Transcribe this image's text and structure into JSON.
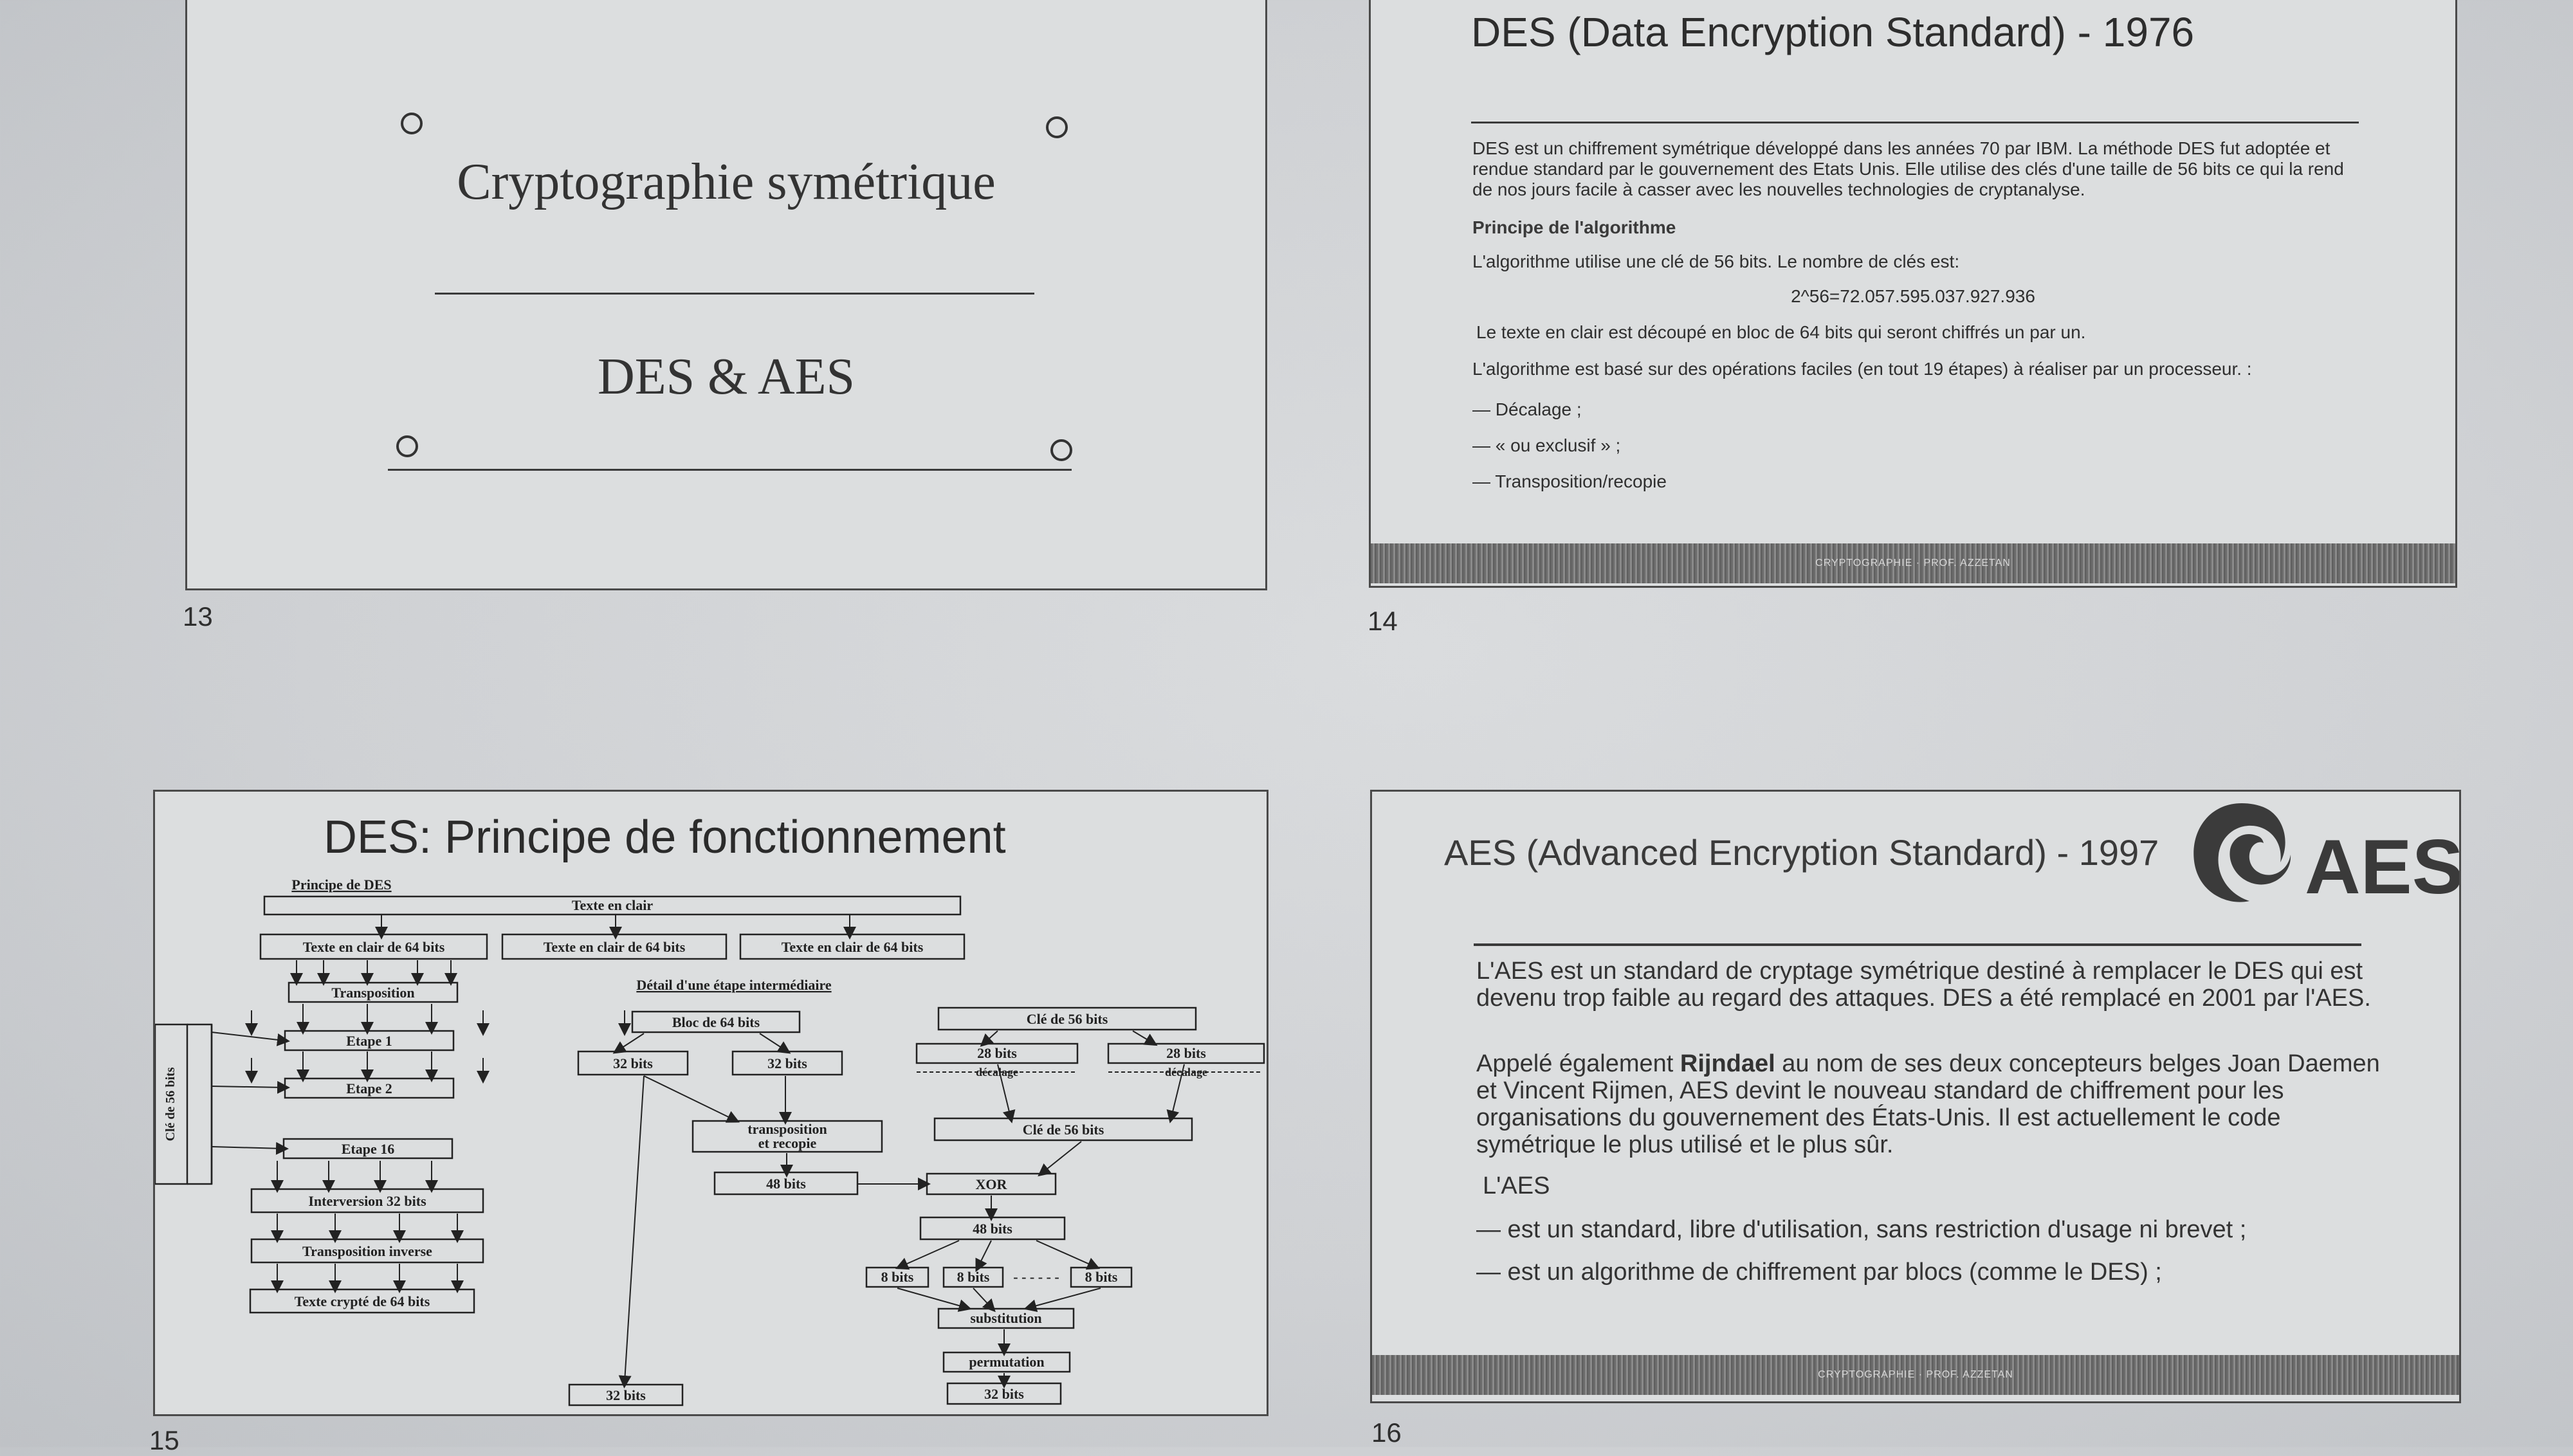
{
  "slides": {
    "s13": {
      "title": "Cryptographie symétrique",
      "subtitle": "DES & AES",
      "page_number": "13"
    },
    "s14": {
      "title": "DES (Data Encryption Standard) - 1976",
      "intro": "DES est un chiffrement symétrique développé dans les années 70 par IBM. La méthode DES fut adoptée et rendue standard par le gouvernement des Etats Unis. Elle utilise des clés d'une taille de 56 bits ce qui la rend de nos jours facile à casser avec les nouvelles technologies de cryptanalyse.",
      "section": "Principe de l'algorithme",
      "key_line": "L'algorithme utilise une clé de 56 bits. Le nombre de clés est:",
      "formula": "2^56=72.057.595.037.927.936",
      "block_line": "Le texte en clair est découpé en bloc de 64 bits qui seront chiffrés un par un.",
      "ops_line": "L'algorithme est basé sur des opérations faciles (en tout 19 étapes) à réaliser par un processeur. :",
      "ops": [
        "— Décalage ;",
        "— « ou exclusif » ;",
        "— Transposition/recopie"
      ],
      "footer": "CRYPTOGRAPHIE · PROF. AZZETAN",
      "page_number": "14"
    },
    "s15": {
      "title": "DES: Principe de fonctionnement",
      "diagram": {
        "left_heading": "Principe de DES",
        "plain_text": "Texte en clair",
        "block64": [
          "Texte en clair de 64 bits",
          "Texte en clair de 64 bits",
          "Texte en clair de 64 bits"
        ],
        "transposition": "Transposition",
        "etape1": "Etape 1",
        "etape2": "Etape 2",
        "etape16": "Etape 16",
        "interversion": "Interversion 32 bits",
        "transposition_inverse": "Transposition inverse",
        "cipher": "Texte crypté de 64 bits",
        "key_label": "Clé de 56 bits",
        "right_heading": "Détail d'une étape intermédiaire",
        "bloc64": "Bloc de 64 bits",
        "bits32": "32 bits",
        "transpo_recopie_1": "transposition",
        "transpo_recopie_2": "et recopie",
        "bits48": "48 bits",
        "cle56": "Clé de 56 bits",
        "bits28": "28 bits",
        "decalage": "décalage",
        "xor": "XOR",
        "bits6": "8 bits",
        "dots": "- - - - - -",
        "substitution": "substitution",
        "permutation": "permutation"
      },
      "page_number": "15"
    },
    "s16": {
      "title": "AES (Advanced Encryption Standard) - 1997",
      "logo_text": "AES",
      "p1": "L'AES est un standard de cryptage symétrique destiné à remplacer le DES qui est devenu trop faible au regard des attaques. DES a été remplacé en 2001 par l'AES.",
      "p2_pre": "Appelé également ",
      "p2_bold": "Rijndael",
      "p2_post": " au nom de ses deux concepteurs belges Joan Daemen et Vincent Rijmen, AES devint le nouveau standard de chiffrement pour les organisations du gouvernement des États-Unis. Il est actuellement le code symétrique le plus utilisé et le plus sûr.",
      "lead": "L'AES",
      "bullets": [
        "— est un standard, libre d'utilisation, sans restriction d'usage ni brevet ;",
        "— est un algorithme de chiffrement par blocs (comme le DES) ;"
      ],
      "footer": "CRYPTOGRAPHIE · PROF. AZZETAN",
      "page_number": "16"
    }
  }
}
